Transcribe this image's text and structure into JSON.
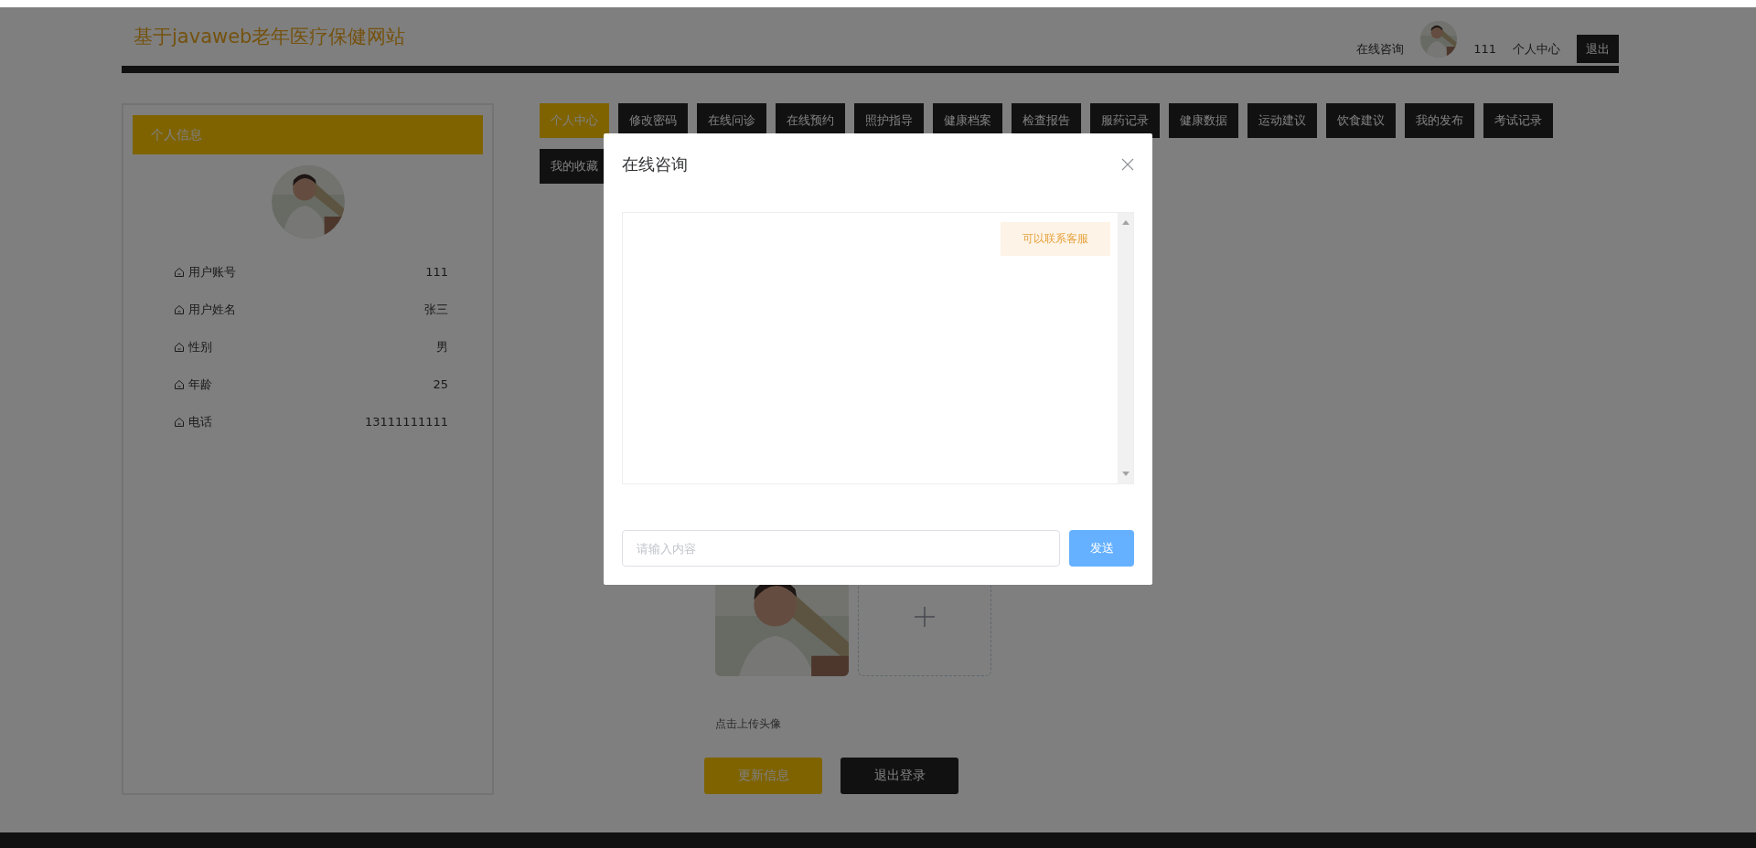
{
  "header": {
    "title": "基于javaweb老年医疗保健网站",
    "consult_link": "在线咨询",
    "username": "111",
    "profile_link": "个人中心",
    "logout_button": "退出"
  },
  "sidebar": {
    "title": "个人信息",
    "fields": [
      {
        "label": "用户账号",
        "value": "111"
      },
      {
        "label": "用户姓名",
        "value": "张三"
      },
      {
        "label": "性别",
        "value": "男"
      },
      {
        "label": "年龄",
        "value": "25"
      },
      {
        "label": "电话",
        "value": "13111111111"
      }
    ]
  },
  "tabs": [
    {
      "label": "个人中心",
      "selected": true
    },
    {
      "label": "修改密码",
      "selected": false
    },
    {
      "label": "在线问诊",
      "selected": false
    },
    {
      "label": "在线预约",
      "selected": false
    },
    {
      "label": "照护指导",
      "selected": false
    },
    {
      "label": "健康档案",
      "selected": false
    },
    {
      "label": "检查报告",
      "selected": false
    },
    {
      "label": "服药记录",
      "selected": false
    },
    {
      "label": "健康数据",
      "selected": false
    },
    {
      "label": "运动建议",
      "selected": false
    },
    {
      "label": "饮食建议",
      "selected": false
    },
    {
      "label": "我的发布",
      "selected": false
    },
    {
      "label": "考试记录",
      "selected": false
    },
    {
      "label": "我的收藏",
      "selected": false
    }
  ],
  "upload": {
    "hint": "点击上传头像"
  },
  "buttons": [
    {
      "label": "更新信息",
      "kind": "primary"
    },
    {
      "label": "退出登录",
      "kind": "dark"
    }
  ],
  "dialog": {
    "title": "在线咨询",
    "messages": [
      {
        "text": "可以联系客服"
      }
    ],
    "input": {
      "placeholder": "请输入内容"
    },
    "send_button": "发送"
  }
}
